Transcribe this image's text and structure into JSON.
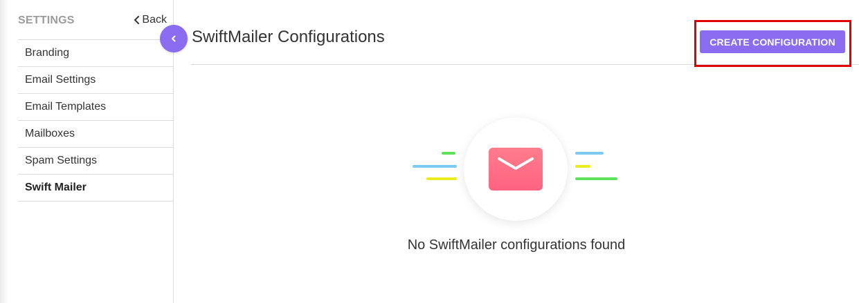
{
  "sidebar": {
    "title": "SETTINGS",
    "back_label": "Back",
    "items": [
      {
        "label": "Branding",
        "active": false
      },
      {
        "label": "Email Settings",
        "active": false
      },
      {
        "label": "Email Templates",
        "active": false
      },
      {
        "label": "Mailboxes",
        "active": false
      },
      {
        "label": "Spam Settings",
        "active": false
      },
      {
        "label": "Swift Mailer",
        "active": true
      }
    ]
  },
  "header": {
    "title": "SwiftMailer Configurations",
    "create_button_label": "CREATE CONFIGURATION"
  },
  "empty_state": {
    "message": "No SwiftMailer configurations found",
    "icon": "envelope-icon"
  },
  "colors": {
    "accent": "#8a6cf1",
    "highlight": "#e00000",
    "envelope": "#ff6f86",
    "line_green": "#5de35a",
    "line_blue": "#7cc9f2",
    "line_yellow": "#ecec1c"
  }
}
